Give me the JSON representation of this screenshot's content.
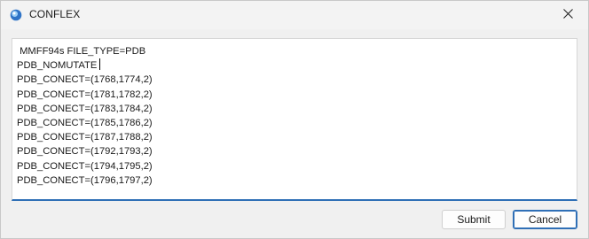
{
  "window": {
    "title": "CONFLEX"
  },
  "editor": {
    "lines": [
      " MMFF94s FILE_TYPE=PDB",
      "PDB_NOMUTATE",
      "PDB_CONECT=(1768,1774,2)",
      "PDB_CONECT=(1781,1782,2)",
      "PDB_CONECT=(1783,1784,2)",
      "PDB_CONECT=(1785,1786,2)",
      "PDB_CONECT=(1787,1788,2)",
      "PDB_CONECT=(1792,1793,2)",
      "PDB_CONECT=(1794,1795,2)",
      "PDB_CONECT=(1796,1797,2)"
    ]
  },
  "buttons": {
    "submit_label": "Submit",
    "cancel_label": "Cancel"
  },
  "icons": {
    "app": "conflex-app-icon",
    "close": "close-icon"
  },
  "colors": {
    "accent": "#2f6fb6"
  }
}
